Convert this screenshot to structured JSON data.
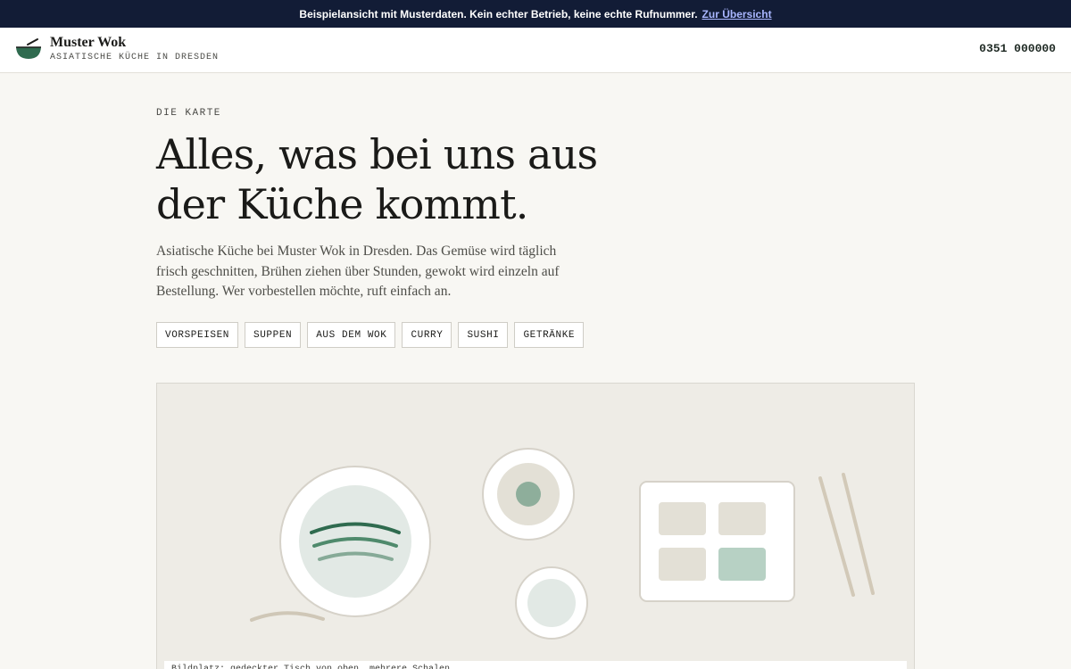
{
  "banner": {
    "text": "Beispielansicht mit Musterdaten. Kein echter Betrieb, keine echte Rufnummer.",
    "link_label": "Zur Übersicht"
  },
  "header": {
    "brand_name": "Muster Wok",
    "tagline": "ASIATISCHE KÜCHE IN DRESDEN",
    "phone": "0351 000000",
    "logo_icon": "wok-bowl-icon"
  },
  "hero": {
    "eyebrow": "DIE KARTE",
    "headline": "Alles, was bei uns aus der Küche kommt.",
    "intro": "Asiatische Küche bei Muster Wok in Dresden. Das Gemüse wird täglich frisch geschnitten, Brühen ziehen über Stunden, gewokt wird einzeln auf Bestellung. Wer vorbestellen möchte, ruft einfach an."
  },
  "categories": [
    "VORSPEISEN",
    "SUPPEN",
    "AUS DEM WOK",
    "CURRY",
    "SUSHI",
    "GETRÄNKE"
  ],
  "illustration": {
    "caption": "Bildplatz: gedeckter Tisch von oben, mehrere Schalen"
  },
  "colors": {
    "banner_bg": "#121c36",
    "banner_link": "#a9b6ff",
    "accent_green": "#2f6b4f",
    "page_bg": "#f8f7f3",
    "illustration_bg": "#eeece6"
  }
}
